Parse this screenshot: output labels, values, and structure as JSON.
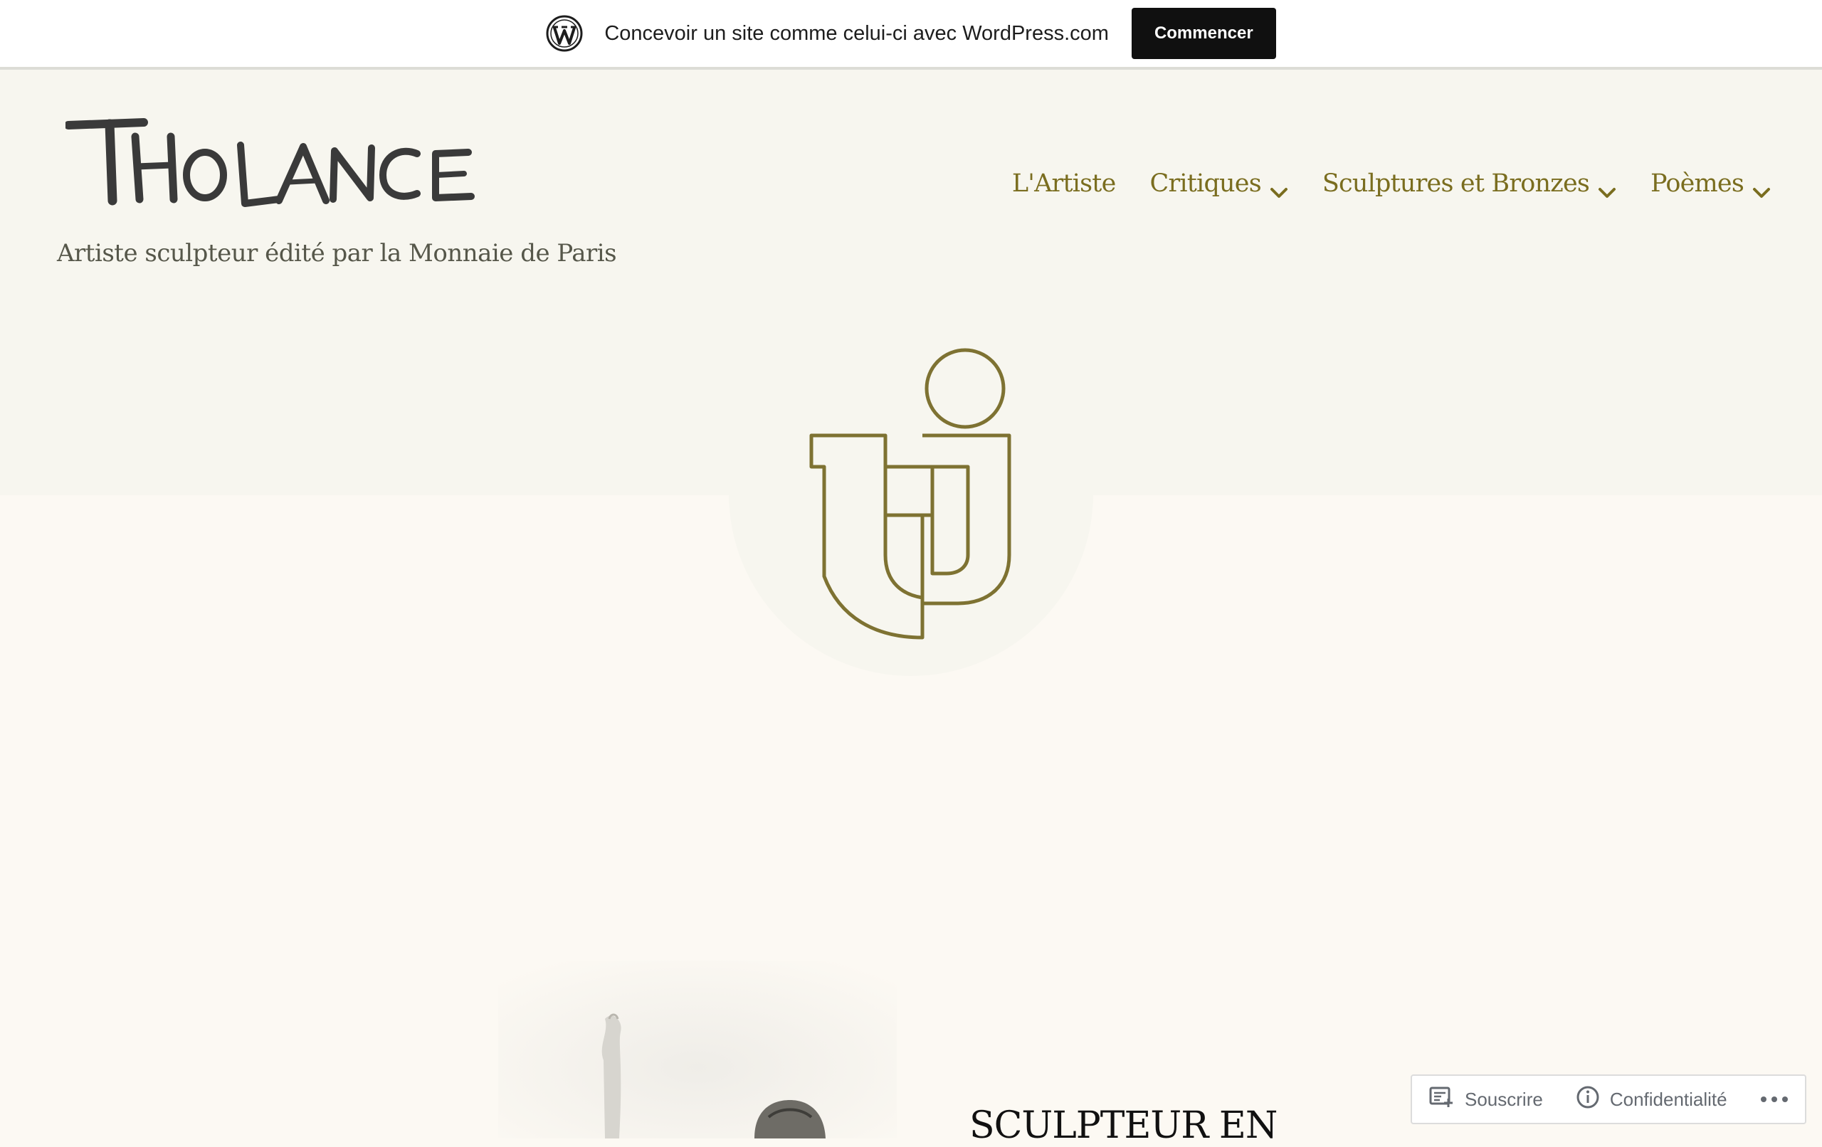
{
  "wp_bar": {
    "message": "Concevoir un site comme celui-ci avec WordPress.com",
    "button_label": "Commencer"
  },
  "header": {
    "logo_text": "THOLANCE",
    "tagline": "Artiste sculpteur édité par la Monnaie de Paris"
  },
  "nav": {
    "items": [
      {
        "label": "L'Artiste"
      },
      {
        "label": "Critiques"
      },
      {
        "label": "Sculptures et Bronzes"
      },
      {
        "label": "Poèmes"
      }
    ]
  },
  "content": {
    "heading": "SCULPTEUR EN"
  },
  "action_bar": {
    "subscribe_label": "Souscrire",
    "privacy_label": "Confidentialité"
  },
  "colors": {
    "accent": "#7a6d1f",
    "emblem_stroke": "#7e7232",
    "header_bg": "#f7f6ef",
    "page_bg": "#fcf9f3"
  }
}
